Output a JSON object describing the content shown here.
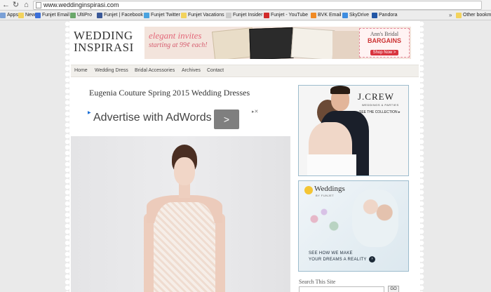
{
  "browser": {
    "url": "www.weddinginspirasi.com",
    "bookmarks": [
      {
        "label": "Apps",
        "color": "#7aa0d6"
      },
      {
        "label": "News",
        "color": "#f3d35d"
      },
      {
        "label": "Funjet Email",
        "color": "#3b6fd9"
      },
      {
        "label": "UltiPro",
        "color": "#6aa86a"
      },
      {
        "label": "Funjet | Facebook",
        "color": "#3b5998"
      },
      {
        "label": "Funjet Twitter",
        "color": "#4aa3df"
      },
      {
        "label": "Funjet Vacations",
        "color": "#f3d35d"
      },
      {
        "label": "Funjet Insider",
        "color": "#cccccc"
      },
      {
        "label": "Funjet - YouTube",
        "color": "#d12b2b"
      },
      {
        "label": "BVK Email",
        "color": "#f08a24"
      },
      {
        "label": "SkyDrive",
        "color": "#3e8de0"
      },
      {
        "label": "Pandora",
        "color": "#2256a5"
      }
    ],
    "more": "»",
    "other_bookmarks": "Other bookma"
  },
  "site": {
    "logo_line1": "WEDDING",
    "logo_line2": "INSPIRASI",
    "header_ad": {
      "line1": "elegant invites",
      "line2": "starting at 99¢ each!",
      "brand": "Ann's Bridal",
      "brand_sub": "BARGAINS",
      "cta": "Shop Now >"
    },
    "nav": [
      "Home",
      "Wedding Dress",
      "Bridal Accessories",
      "Archives",
      "Contact"
    ]
  },
  "post": {
    "title": "Eugenia Couture Spring 2015 Wedding Dresses",
    "adwords_text": "Advertise with AdWords",
    "adwords_button": ">"
  },
  "sidebar": {
    "ad1": {
      "brand": "J.CREW",
      "sub": "WEDDINGS & PARTIES",
      "link": "SEE THE COLLECTION ▸"
    },
    "ad2": {
      "brand": "Weddings",
      "by": "BY FUNJET",
      "tag1": "SEE HOW WE MAKE",
      "tag2": "YOUR DREAMS A REALITY"
    },
    "search": {
      "label": "Search This Site",
      "button": "GO"
    }
  }
}
